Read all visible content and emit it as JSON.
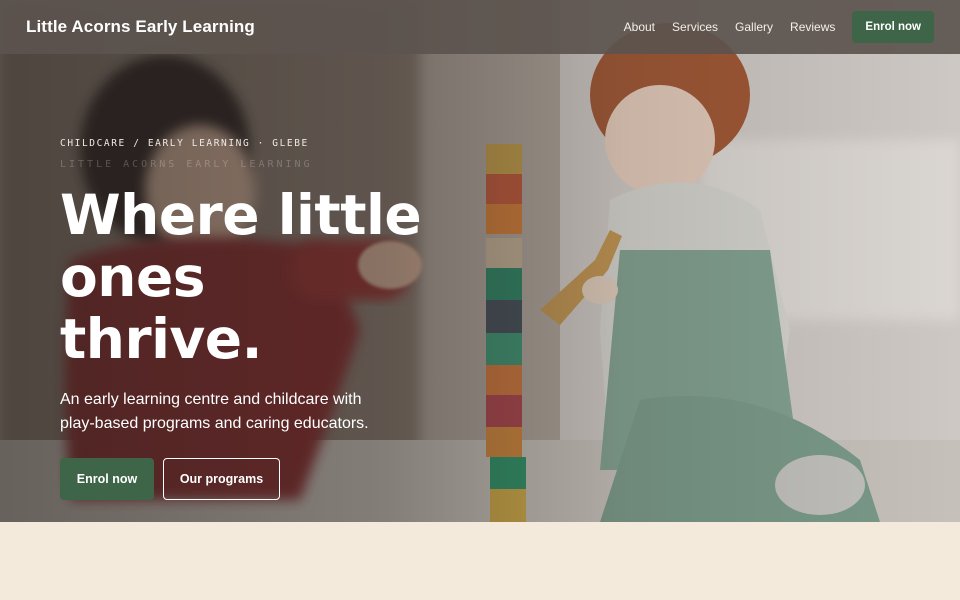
{
  "header": {
    "brand": "Little Acorns Early Learning",
    "nav": [
      "About",
      "Services",
      "Gallery",
      "Reviews"
    ],
    "cta": "Enrol now"
  },
  "hero": {
    "eyebrow": "CHILDCARE / EARLY LEARNING · GLEBE",
    "ghost_text": "LITTLE ACORNS EARLY LEARNING",
    "headline_line1": "Where little ones",
    "headline_line2": "thrive.",
    "subtitle": "An early learning centre and childcare with play-based programs and caring educators.",
    "primary_button": "Enrol now",
    "secondary_button": "Our programs"
  },
  "colors": {
    "accent_green": "#3f6548",
    "header_bg": "#5c544e",
    "page_bg": "#f3eadc"
  }
}
